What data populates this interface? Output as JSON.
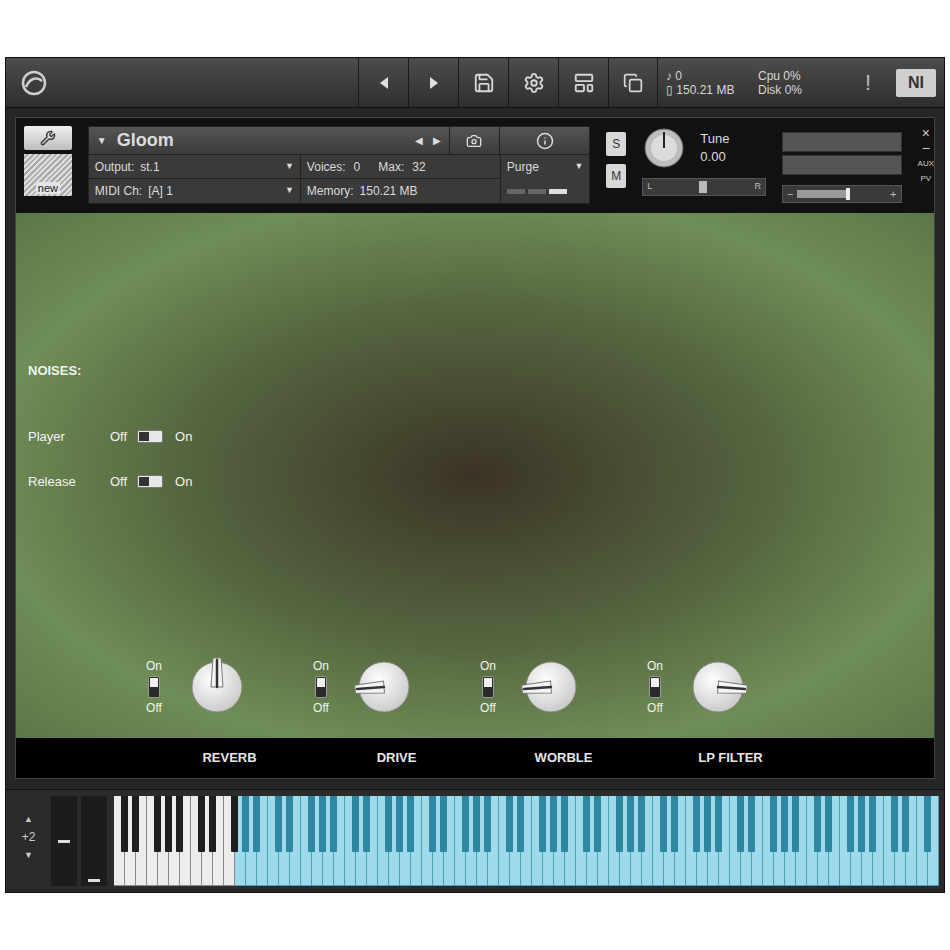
{
  "toolbar": {
    "voices": "0",
    "memory": "150.21 MB",
    "cpu_label": "Cpu",
    "cpu": "0%",
    "disk_label": "Disk",
    "disk": "0%",
    "alert": "!",
    "brand": "NI"
  },
  "instrument": {
    "name": "Gloom",
    "output_label": "Output:",
    "output": "st.1",
    "voices_label": "Voices:",
    "voices": "0",
    "max_label": "Max:",
    "max": "32",
    "midi_label": "MIDI Ch:",
    "midi": "[A] 1",
    "memory_label": "Memory:",
    "memory": "150.21 MB",
    "purge": "Purge",
    "new_label": "new",
    "solo": "S",
    "mute": "M",
    "tune_label": "Tune",
    "tune": "0.00",
    "pan_left": "L",
    "pan_right": "R",
    "pan_level": 0.5,
    "volume_level": 0.55,
    "close": "×",
    "minimize": "−",
    "aux": "AUX",
    "pv": "PV",
    "vol_minus": "−",
    "vol_plus": "+"
  },
  "noises": {
    "title": "NOISES:",
    "items": [
      {
        "label": "Player",
        "off_label": "Off",
        "on_label": "On",
        "on": false
      },
      {
        "label": "Release",
        "off_label": "Off",
        "on_label": "On",
        "on": false
      }
    ]
  },
  "effects": [
    {
      "label": "REVERB",
      "on_label": "On",
      "off_label": "Off",
      "on": true,
      "level": 0.5
    },
    {
      "label": "DRIVE",
      "on_label": "On",
      "off_label": "Off",
      "on": true,
      "level": 0.15
    },
    {
      "label": "WORBLE",
      "on_label": "On",
      "off_label": "Off",
      "on": true,
      "level": 0.15
    },
    {
      "label": "LP FILTER",
      "on_label": "On",
      "off_label": "Off",
      "on": true,
      "level": 0.85
    }
  ],
  "keyboard": {
    "octave_up": "▲",
    "octave": "+2",
    "octave_down": "▼",
    "white_key_count": 75,
    "mapped_from_white_key": 11
  }
}
